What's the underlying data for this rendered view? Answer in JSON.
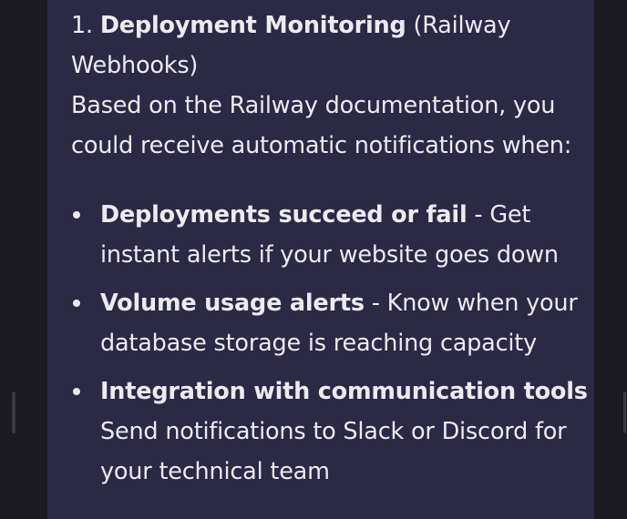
{
  "section": {
    "number": "1.",
    "title": "Deployment Monitoring",
    "title_suffix_line1": "(Railway",
    "title_suffix_line2": "Webhooks)"
  },
  "intro": {
    "line1": "Based on the Railway documentation, you",
    "line2": "could receive automatic notifications when:"
  },
  "bullets": [
    {
      "bold": "Deployments succeed or fail",
      "rest_line1": " - Get",
      "line2": "instant alerts if your website goes down"
    },
    {
      "bold": "Volume usage alerts",
      "rest_line1": " - Know when your",
      "line2": "database storage is reaching capacity"
    },
    {
      "bold": "Integration with communication tools",
      "rest_line1": " -",
      "line2": "Send notifications to Slack or Discord for",
      "line3": "your technical team"
    }
  ],
  "colors": {
    "panel_background": "#2b2945",
    "page_background": "#1b1a22",
    "text": "#ecebf2"
  }
}
